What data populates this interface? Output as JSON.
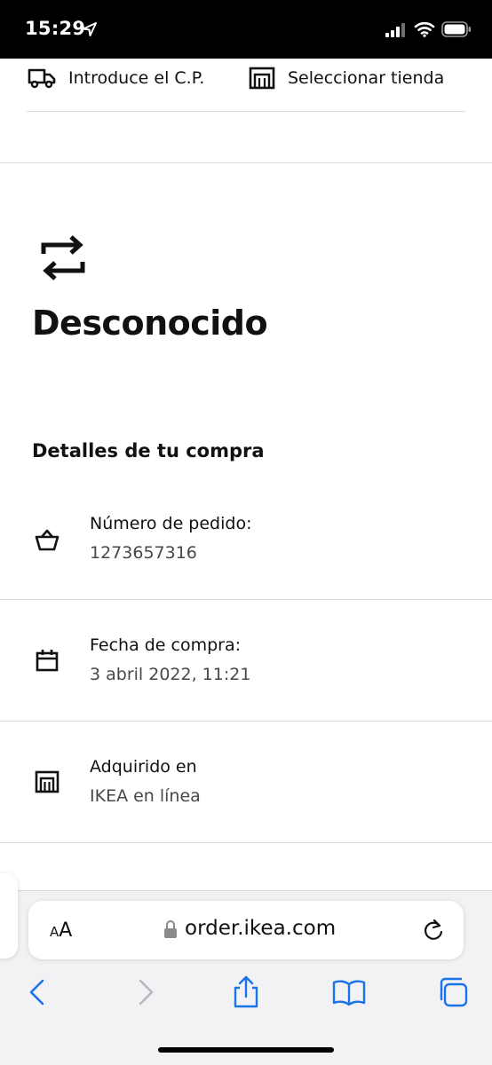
{
  "status_bar": {
    "time": "15:29"
  },
  "header": {
    "postal_code_label": "Introduce el C.P.",
    "store_label": "Seleccionar tienda"
  },
  "order_status": {
    "title": "Desconocido",
    "icon": "exchange-arrows-icon"
  },
  "purchase_details": {
    "heading": "Detalles de tu compra",
    "items": [
      {
        "icon": "basket-icon",
        "label": "Número de pedido:",
        "value": "1273657316"
      },
      {
        "icon": "calendar-icon",
        "label": "Fecha de compra:",
        "value": "3 abril 2022, 11:21"
      },
      {
        "icon": "store-icon",
        "label": "Adquirido en",
        "value": "IKEA en línea"
      }
    ]
  },
  "browser": {
    "text_size_label_small": "A",
    "text_size_label_large": "A",
    "url": "order.ikea.com",
    "toolbar": [
      "back-icon",
      "forward-icon",
      "share-icon",
      "bookmarks-icon",
      "tabs-icon"
    ]
  },
  "colors": {
    "text_primary": "#111111",
    "text_secondary": "#484848",
    "safari_blue": "#1a73e8",
    "divider": "#dddddd"
  }
}
